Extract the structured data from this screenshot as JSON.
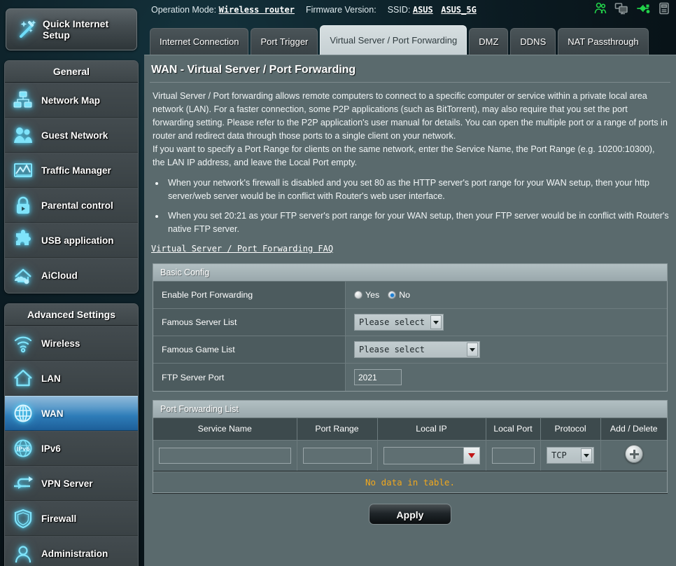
{
  "topbar": {
    "operation_mode_label": "Operation Mode:",
    "operation_mode_value": "Wireless router",
    "firmware_label": "Firmware Version:",
    "firmware_value": "",
    "ssid_label": "SSID:",
    "ssid_value_1": "ASUS",
    "ssid_value_2": "ASUS_5G",
    "icons": [
      "clients-icon",
      "network-monitors-icon",
      "usb-icon",
      "printer-icon"
    ],
    "icon_accent": "#22d24a"
  },
  "sidebar": {
    "quick_setup_label": "Quick Internet Setup",
    "general_header": "General",
    "general_items": [
      {
        "label": "Network Map",
        "icon": "network-map-icon"
      },
      {
        "label": "Guest Network",
        "icon": "guest-network-icon"
      },
      {
        "label": "Traffic Manager",
        "icon": "traffic-manager-icon"
      },
      {
        "label": "Parental control",
        "icon": "parental-control-icon"
      },
      {
        "label": "USB application",
        "icon": "usb-application-icon"
      },
      {
        "label": "AiCloud",
        "icon": "aicloud-icon"
      }
    ],
    "advanced_header": "Advanced Settings",
    "advanced_items": [
      {
        "label": "Wireless",
        "icon": "wireless-icon",
        "active": false
      },
      {
        "label": "LAN",
        "icon": "lan-icon",
        "active": false
      },
      {
        "label": "WAN",
        "icon": "wan-icon",
        "active": true
      },
      {
        "label": "IPv6",
        "icon": "ipv6-icon",
        "active": false
      },
      {
        "label": "VPN Server",
        "icon": "vpn-server-icon",
        "active": false
      },
      {
        "label": "Firewall",
        "icon": "firewall-icon",
        "active": false
      },
      {
        "label": "Administration",
        "icon": "administration-icon",
        "active": false
      }
    ],
    "accent": "#4fd0f5",
    "active_accent": "#2e7cb8"
  },
  "tabs": [
    {
      "label": "Internet Connection",
      "active": false
    },
    {
      "label": "Port Trigger",
      "active": false
    },
    {
      "label": "Virtual Server / Port Forwarding",
      "active": true
    },
    {
      "label": "DMZ",
      "active": false
    },
    {
      "label": "DDNS",
      "active": false
    },
    {
      "label": "NAT Passthrough",
      "active": false
    }
  ],
  "main": {
    "page_title": "WAN - Virtual Server / Port Forwarding",
    "paragraph_1": "Virtual Server / Port forwarding allows remote computers to connect to a specific computer or service within a private local area network (LAN). For a faster connection, some P2P applications (such as BitTorrent), may also require that you set the port forwarding setting. Please refer to the P2P application's user manual for details. You can open the multiple port or a range of ports in router and redirect data through those ports to a single client on your network.",
    "paragraph_2": "If you want to specify a Port Range for clients on the same network, enter the Service Name, the Port Range (e.g. 10200:10300), the LAN IP address, and leave the Local Port empty.",
    "notes": [
      "When your network's firewall is disabled and you set 80 as the HTTP server's port range for your WAN setup, then your http server/web server would be in conflict with Router's web user interface.",
      "When you set 20:21 as your FTP server's port range for your WAN setup, then your FTP server would be in conflict with Router's native FTP server."
    ],
    "faq_link": "Virtual Server / Port Forwarding FAQ"
  },
  "basic_config": {
    "header": "Basic Config",
    "enable_label": "Enable Port Forwarding",
    "enable_yes": "Yes",
    "enable_no": "No",
    "enable_selected": "No",
    "famous_server_label": "Famous Server List",
    "famous_server_value": "Please select",
    "famous_game_label": "Famous Game List",
    "famous_game_value": "Please select",
    "ftp_port_label": "FTP Server Port",
    "ftp_port_value": "2021"
  },
  "forwarding_list": {
    "header": "Port Forwarding List",
    "columns": [
      "Service Name",
      "Port Range",
      "Local IP",
      "Local Port",
      "Protocol",
      "Add / Delete"
    ],
    "entry_row": {
      "service_name": "",
      "port_range": "",
      "local_ip": "",
      "local_port": "",
      "protocol": "TCP",
      "add_icon": "plus-circle-icon"
    },
    "empty_message": "No data in table.",
    "empty_color": "#f0a81e"
  },
  "footer": {
    "apply_label": "Apply"
  }
}
